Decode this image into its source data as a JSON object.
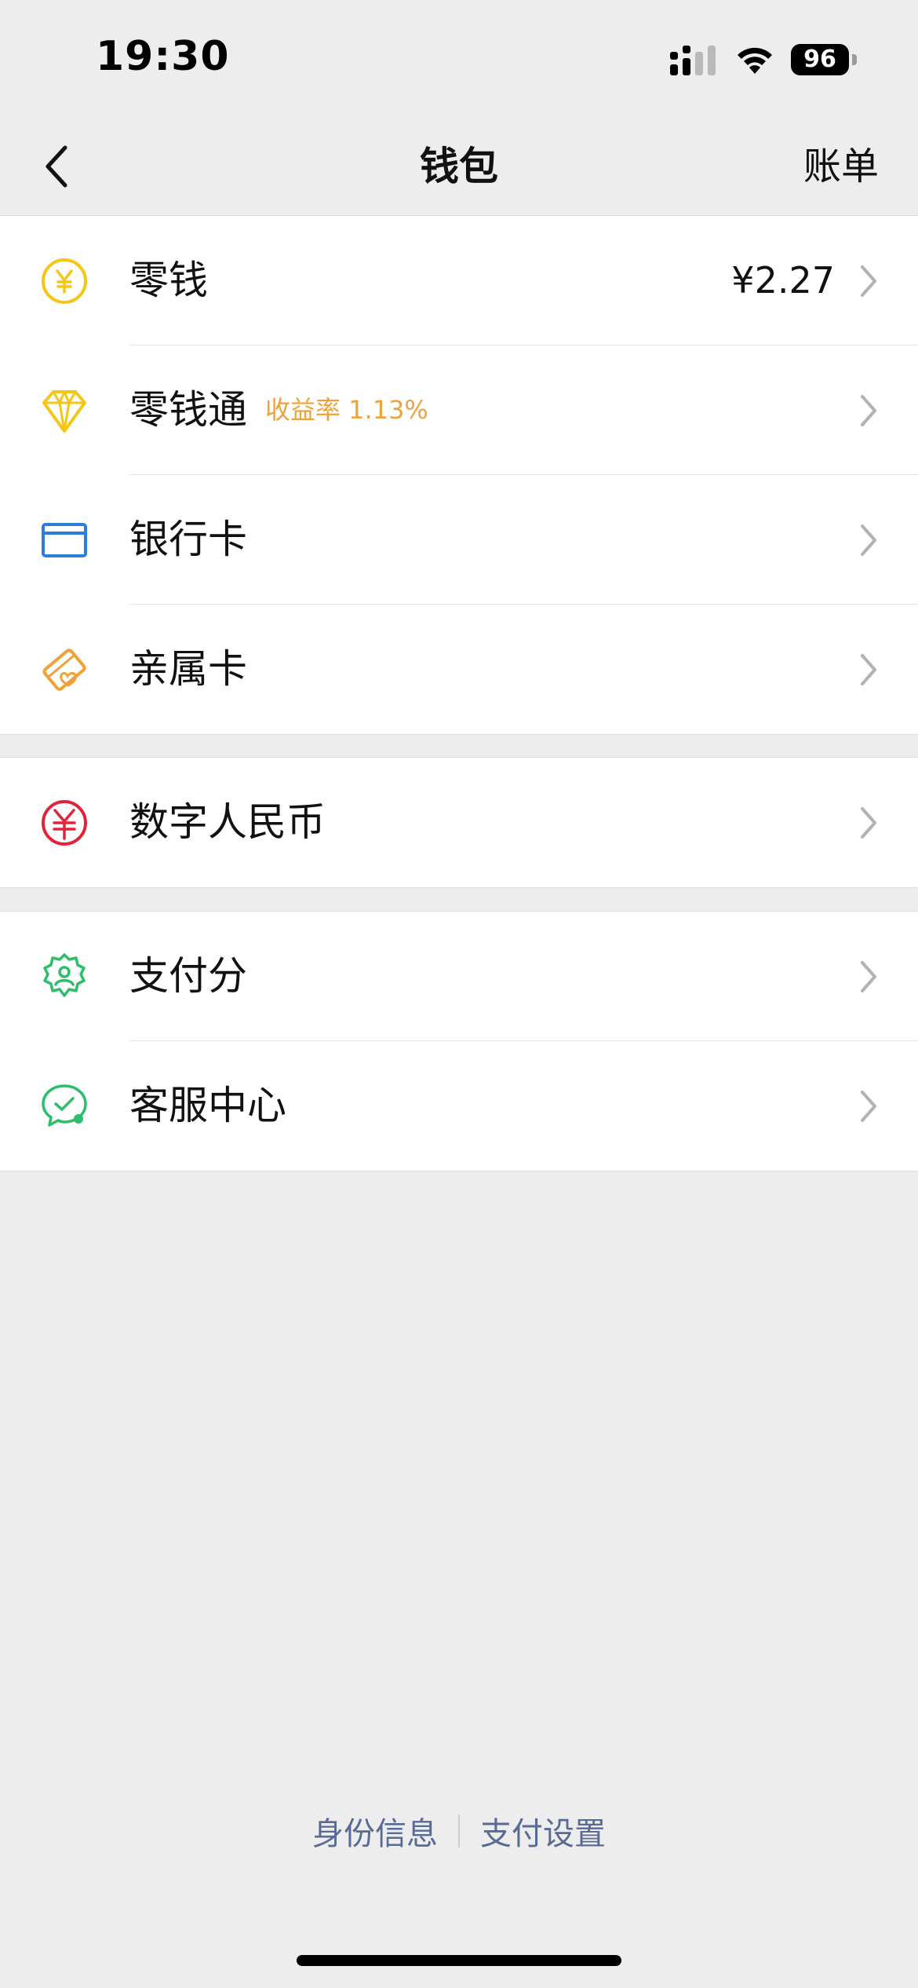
{
  "status_bar": {
    "time": "19:30",
    "battery": "96"
  },
  "nav": {
    "title": "钱包",
    "action": "账单"
  },
  "groups": [
    {
      "items": [
        {
          "label": "零钱",
          "value": "¥2.27",
          "icon": "yuan-coin-icon",
          "color": "#F5C518"
        },
        {
          "label": "零钱通",
          "tag": "收益率 1.13%",
          "icon": "diamond-icon",
          "color": "#F5C518"
        },
        {
          "label": "银行卡",
          "icon": "bank-card-icon",
          "color": "#2B7FDB"
        },
        {
          "label": "亲属卡",
          "icon": "family-card-icon",
          "color": "#F0A23A"
        }
      ]
    },
    {
      "items": [
        {
          "label": "数字人民币",
          "icon": "digital-rmb-icon",
          "color": "#E0253A"
        }
      ]
    },
    {
      "items": [
        {
          "label": "支付分",
          "icon": "pay-score-icon",
          "color": "#2DBE6C"
        },
        {
          "label": "客服中心",
          "icon": "customer-service-icon",
          "color": "#2DBE6C"
        }
      ]
    }
  ],
  "footer": {
    "identity_link": "身份信息",
    "payment_settings_link": "支付设置"
  },
  "colors": {
    "background": "#EDEDED",
    "link": "#576B95",
    "tag": "#F0A23A"
  }
}
